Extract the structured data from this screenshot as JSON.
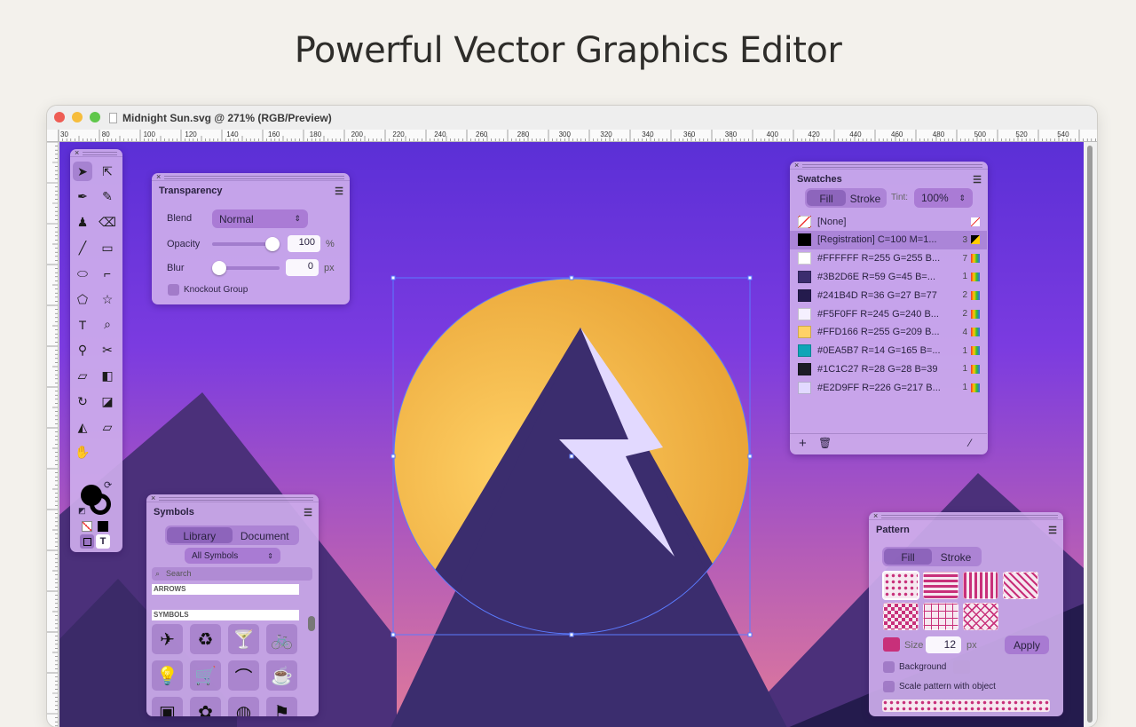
{
  "hero_title": "Powerful Vector Graphics Editor",
  "window": {
    "title": "Midnight Sun.svg @ 271% (RGB/Preview)",
    "ruler_h": [
      "30",
      "80",
      "100",
      "120",
      "140",
      "160",
      "180",
      "200",
      "220",
      "240",
      "260",
      "280",
      "300",
      "320",
      "340",
      "360",
      "380",
      "400",
      "420",
      "440",
      "460",
      "480",
      "500",
      "520",
      "540"
    ]
  },
  "colors": {
    "sky_top": "#6a34d9",
    "sky_bottom": "#d36a9f",
    "mountain_dark": "#3b2d6e",
    "mountain_far": "#4a2f78",
    "sun_a": "#ffd166",
    "sun_b": "#e8a33a",
    "bolt": "#e2d9ff",
    "accent": "#c8307a"
  },
  "tools": [
    "select-arrow-icon",
    "direct-select-icon",
    "pen-icon",
    "pencil-icon",
    "brush-icon",
    "eraser-icon",
    "line-icon",
    "rectangle-icon",
    "ellipse-icon",
    "corner-icon",
    "polygon-icon",
    "star-icon",
    "text-icon",
    "zoom-icon",
    "eyedropper-icon",
    "scissors-icon",
    "ruler-icon",
    "gradient-icon",
    "rotate-icon",
    "scale-icon",
    "mirror-icon",
    "shear-icon",
    "hand-icon"
  ],
  "transparency": {
    "title": "Transparency",
    "blend_label": "Blend",
    "blend_value": "Normal",
    "opacity_label": "Opacity",
    "opacity_value": "100",
    "opacity_unit": "%",
    "opacity_level": 1.0,
    "blur_label": "Blur",
    "blur_value": "0",
    "blur_unit": "px",
    "blur_level": 0.0,
    "knockout_label": "Knockout Group"
  },
  "swatches": {
    "title": "Swatches",
    "fill_tab": "Fill",
    "stroke_tab": "Stroke",
    "tint_label": "Tint:",
    "tint_value": "100%",
    "items": [
      {
        "name": "[None]",
        "count": "",
        "color": "none"
      },
      {
        "name": "[Registration] C=100 M=1...",
        "count": "3",
        "color": "#000000"
      },
      {
        "name": "#FFFFFF R=255 G=255 B...",
        "count": "7",
        "color": "#FFFFFF"
      },
      {
        "name": "#3B2D6E R=59 G=45 B=...",
        "count": "1",
        "color": "#3B2D6E"
      },
      {
        "name": "#241B4D R=36 G=27 B=77",
        "count": "2",
        "color": "#241B4D"
      },
      {
        "name": "#F5F0FF R=245 G=240 B...",
        "count": "2",
        "color": "#F5F0FF"
      },
      {
        "name": "#FFD166 R=255 G=209 B...",
        "count": "4",
        "color": "#FFD166"
      },
      {
        "name": "#0EA5B7 R=14 G=165 B=...",
        "count": "1",
        "color": "#0EA5B7"
      },
      {
        "name": "#1C1C27 R=28 G=28 B=39",
        "count": "1",
        "color": "#1C1C27"
      },
      {
        "name": "#E2D9FF R=226 G=217 B...",
        "count": "1",
        "color": "#E2D9FF"
      }
    ]
  },
  "symbols": {
    "title": "Symbols",
    "library_tab": "Library",
    "document_tab": "Document",
    "filter_value": "All Symbols",
    "search_placeholder": "Search",
    "section_arrows": "ARROWS",
    "section_symbols": "SYMBOLS",
    "icons": [
      "airplane-icon",
      "recycle-icon",
      "cocktail-icon",
      "bicycle-icon",
      "lightbulb-icon",
      "cart-icon",
      "hanger-icon",
      "coffee-icon",
      "book-icon",
      "gift-icon",
      "globe-icon",
      "flag-icon"
    ],
    "glyphs": [
      "✈",
      "♻",
      "🍸",
      "🚲",
      "💡",
      "🛒",
      "⌒",
      "☕",
      "▣",
      "✿",
      "◍",
      "⚑"
    ]
  },
  "pattern": {
    "title": "Pattern",
    "fill_tab": "Fill",
    "stroke_tab": "Stroke",
    "size_label": "Size",
    "size_value": "12",
    "size_unit": "px",
    "apply_label": "Apply",
    "background_label": "Background",
    "scale_label": "Scale pattern with object"
  }
}
